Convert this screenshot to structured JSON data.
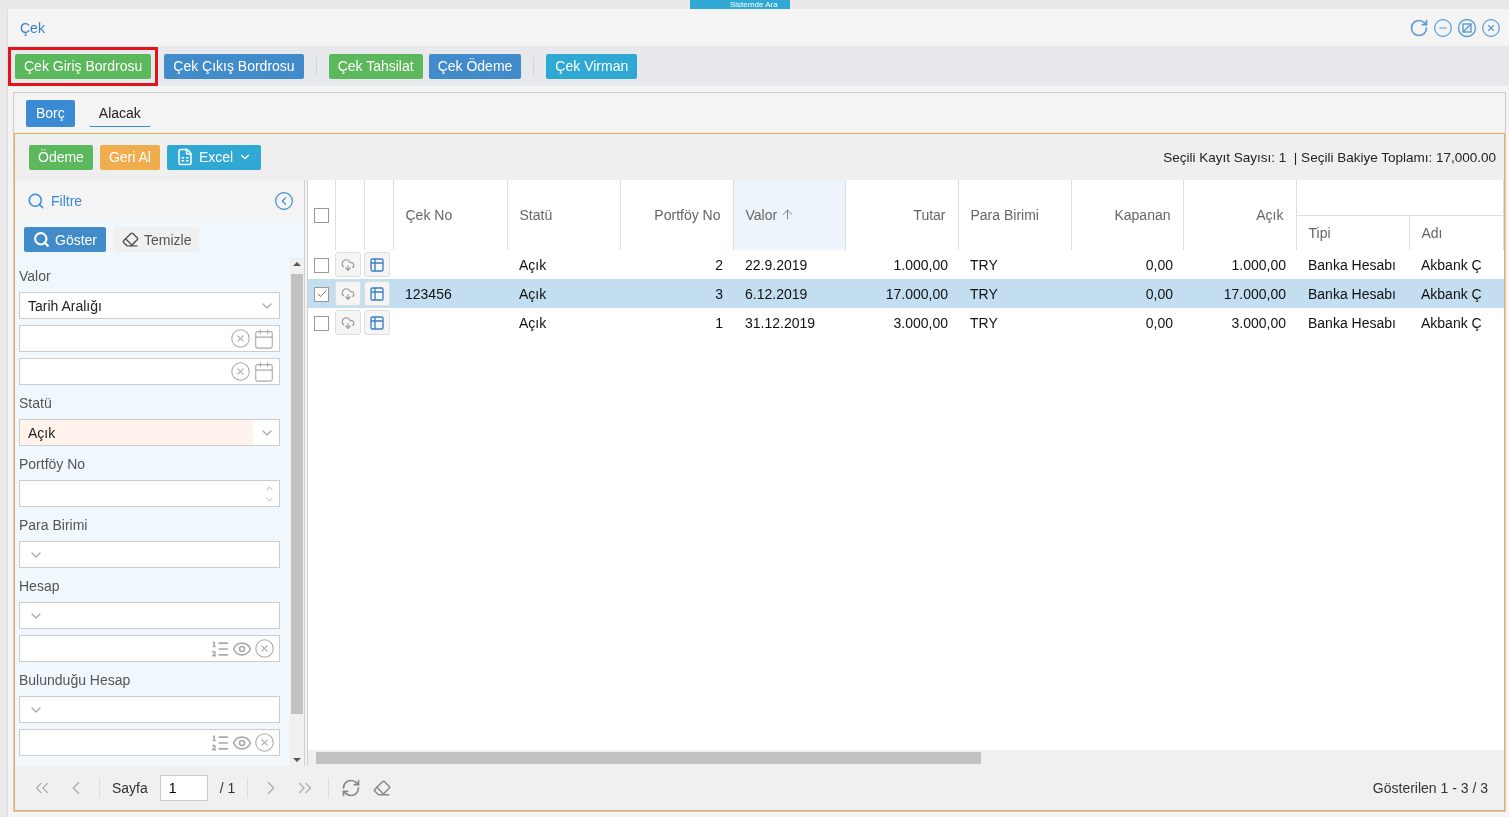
{
  "background_tab": {
    "label": "Sistemde Ara"
  },
  "window": {
    "title": "Çek"
  },
  "toolbar_groups": [
    {
      "buttons": [
        {
          "label": "Çek Giriş Bordrosu",
          "kind": "success",
          "highlighted": true
        },
        {
          "label": "Çek Çıkış Bordrosu",
          "kind": "primary",
          "highlighted": false
        }
      ]
    },
    {
      "buttons": [
        {
          "label": "Çek Tahsilat",
          "kind": "success",
          "highlighted": false
        },
        {
          "label": "Çek Ödeme",
          "kind": "primary",
          "highlighted": false
        }
      ]
    },
    {
      "buttons": [
        {
          "label": "Çek Virman",
          "kind": "info",
          "highlighted": false
        }
      ]
    }
  ],
  "tabs": [
    {
      "label": "Borç",
      "selected": true
    },
    {
      "label": "Alacak",
      "selected": false
    }
  ],
  "actions": [
    {
      "label": "Ödeme",
      "kind": "success",
      "dropdown": false
    },
    {
      "label": "Geri Al",
      "kind": "warning",
      "dropdown": false
    },
    {
      "label": "Excel",
      "kind": "info",
      "dropdown": true
    }
  ],
  "summary": [
    "Seçili Kayıt Sayısı: 1",
    "| Seçili Bakiye Toplamı: 17,000.00"
  ],
  "filter": {
    "title": "Filtre",
    "show_button": "Göster",
    "clear_button": "Temizle",
    "fields": [
      {
        "label": "Valor",
        "controls": [
          {
            "kind": "select",
            "value": "Tarih Aralığı",
            "highlighted": false
          },
          {
            "kind": "date"
          },
          {
            "kind": "date"
          }
        ]
      },
      {
        "label": "Statü",
        "controls": [
          {
            "kind": "select",
            "value": "Açık",
            "highlighted": true
          }
        ]
      },
      {
        "label": "Portföy No",
        "controls": [
          {
            "kind": "number"
          }
        ]
      },
      {
        "label": "Para Birimi",
        "controls": [
          {
            "kind": "select",
            "highlighted": false
          }
        ]
      },
      {
        "label": "Hesap",
        "controls": [
          {
            "kind": "select",
            "highlighted": false
          },
          {
            "kind": "lookup"
          }
        ]
      },
      {
        "label": "Bulunduğu Hesap",
        "controls": [
          {
            "kind": "select",
            "highlighted": false
          },
          {
            "kind": "lookup"
          }
        ]
      }
    ]
  },
  "grid": {
    "all_checked": false,
    "columns": [
      {
        "label": "Çek No",
        "kind": "text",
        "sorted": false
      },
      {
        "label": "Statü",
        "kind": "text",
        "sorted": false
      },
      {
        "label": "Portföy No",
        "kind": "number",
        "sorted": false
      },
      {
        "label": "Valor",
        "kind": "text",
        "sorted": true
      },
      {
        "label": "Tutar",
        "kind": "number",
        "sorted": false
      },
      {
        "label": "Para Birimi",
        "kind": "text",
        "sorted": false
      },
      {
        "label": "Kapanan",
        "kind": "number",
        "sorted": false
      },
      {
        "label": "Açık",
        "kind": "number",
        "sorted": false
      }
    ],
    "group_columns": [
      {
        "label": "Tipi"
      },
      {
        "label": "Adı"
      }
    ],
    "rows": [
      {
        "selected": false,
        "cells": [
          "",
          "Açık",
          "2",
          "22.9.2019",
          "1.000,00",
          "TRY",
          "0,00",
          "1.000,00",
          "Banka Hesabı",
          "Akbank Ç"
        ]
      },
      {
        "selected": true,
        "cells": [
          "123456",
          "Açık",
          "3",
          "6.12.2019",
          "17.000,00",
          "TRY",
          "0,00",
          "17.000,00",
          "Banka Hesabı",
          "Akbank Ç"
        ]
      },
      {
        "selected": false,
        "cells": [
          "",
          "Açık",
          "1",
          "31.12.2019",
          "3.000,00",
          "TRY",
          "0,00",
          "3.000,00",
          "Banka Hesabı",
          "Akbank Ç"
        ]
      }
    ]
  },
  "pager": {
    "page_label": "Sayfa",
    "page": "1",
    "total": "/ 1",
    "info": "Gösterilen 1 - 3 / 3"
  }
}
